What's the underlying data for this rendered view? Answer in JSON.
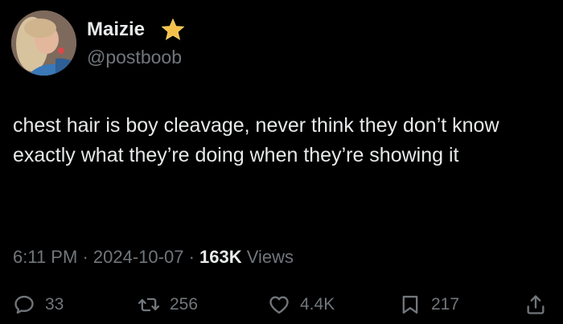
{
  "author": {
    "display_name": "Maizie",
    "handle": "@postboob",
    "badge_icon": "star-badge-icon",
    "badge_color": "#f5c04a"
  },
  "tweet": {
    "text": "chest hair is boy cleavage, never think they don’t know exactly what they’re doing when they’re showing it"
  },
  "meta": {
    "time": "6:11 PM",
    "date": "2024-10-07",
    "separator": "·",
    "views_count": "163K",
    "views_label": "Views"
  },
  "actions": {
    "reply": {
      "icon": "reply-icon",
      "count": "33"
    },
    "repost": {
      "icon": "repost-icon",
      "count": "256"
    },
    "like": {
      "icon": "heart-icon",
      "count": "4.4K"
    },
    "bookmark": {
      "icon": "bookmark-icon",
      "count": "217"
    },
    "share": {
      "icon": "share-icon"
    }
  },
  "colors": {
    "background": "#000000",
    "text_primary": "#e7e9ea",
    "text_secondary": "#71767b"
  }
}
